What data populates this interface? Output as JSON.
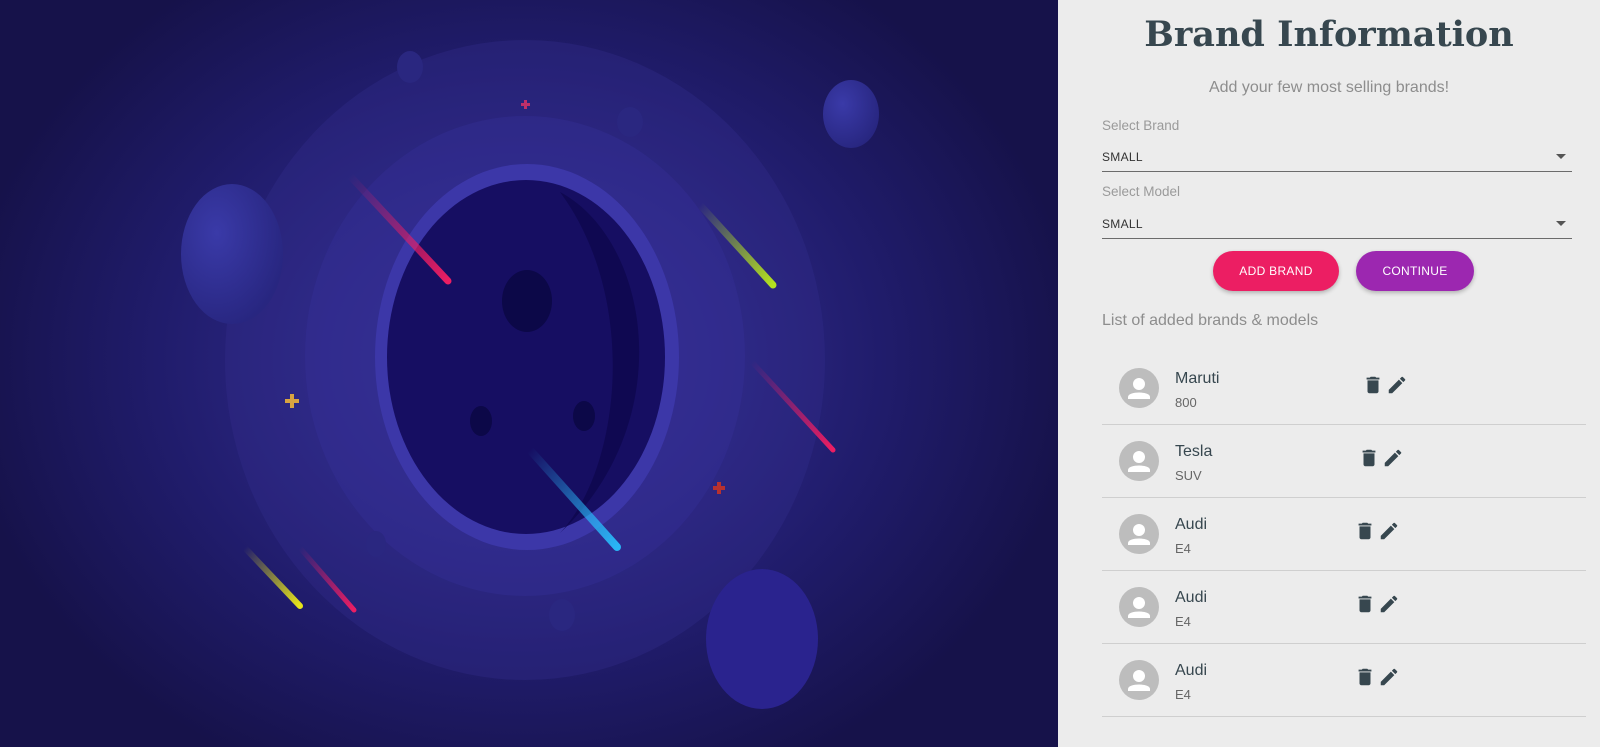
{
  "panel": {
    "title": "Brand Information",
    "subtitle": "Add your few most selling brands!",
    "brand_select": {
      "label": "Select Brand",
      "value": "SMALL",
      "icon": "chevron-down-icon"
    },
    "model_select": {
      "label": "Select Model",
      "value": "SMALL",
      "icon": "chevron-down-icon"
    },
    "buttons": {
      "add_label": "ADD BRAND",
      "continue_label": "CONTINUE"
    },
    "list_title": "List of added brands & models",
    "items": [
      {
        "name": "Maruti",
        "model": "800"
      },
      {
        "name": "Tesla",
        "model": "SUV"
      },
      {
        "name": "Audi",
        "model": "E4"
      },
      {
        "name": "Audi",
        "model": "E4"
      },
      {
        "name": "Audi",
        "model": "E4"
      }
    ],
    "item_icons": {
      "avatar": "person-icon",
      "delete": "trash-icon",
      "edit": "pencil-icon"
    }
  },
  "colors": {
    "add_button": "#ec1e63",
    "continue_button": "#9c27b0",
    "title_text": "#37474f",
    "icon": "#37474f",
    "avatar_bg": "#bdbdbd",
    "illustration_bg": "#221d6e"
  }
}
